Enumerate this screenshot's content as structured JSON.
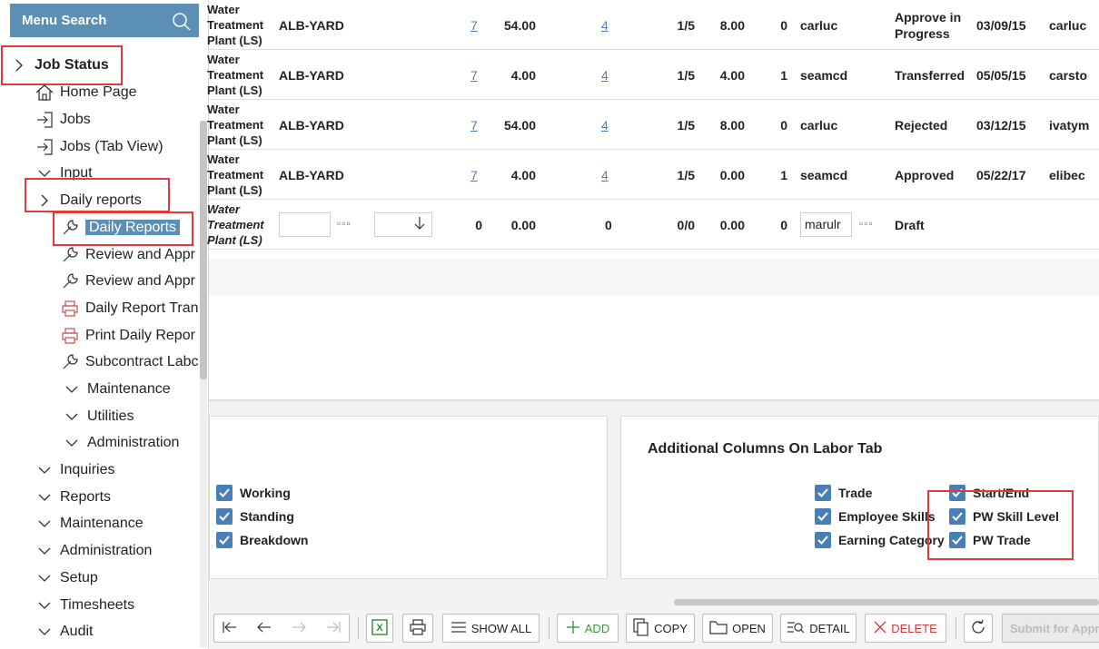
{
  "sidebar": {
    "search_label": "Menu Search",
    "icons": {
      "search": "search-icon",
      "home": "home-icon",
      "arrow_box": "arrow-into-box-icon",
      "wrench": "wrench-icon",
      "printer": "printer-icon"
    },
    "items": [
      {
        "label": "Job Status",
        "expander": ">",
        "icon": ""
      },
      {
        "label": "Home Page",
        "expander": "",
        "icon": "home-icon"
      },
      {
        "label": "Jobs",
        "expander": "",
        "icon": "arrow-into-box-icon"
      },
      {
        "label": "Jobs (Tab View)",
        "expander": "",
        "icon": "arrow-into-box-icon"
      },
      {
        "label": "Input",
        "expander": "v",
        "icon": ""
      },
      {
        "label": "Daily reports",
        "expander": ">",
        "icon": ""
      },
      {
        "label": "Daily Reports",
        "expander": "",
        "icon": "wrench-icon"
      },
      {
        "label": "Review and Appr",
        "expander": "",
        "icon": "wrench-icon"
      },
      {
        "label": "Review and Appr",
        "expander": "",
        "icon": "wrench-icon"
      },
      {
        "label": "Daily Report Tran",
        "expander": "",
        "icon": "printer-icon"
      },
      {
        "label": "Print Daily Repor",
        "expander": "",
        "icon": "printer-icon"
      },
      {
        "label": "Subcontract Labc",
        "expander": "",
        "icon": "wrench-icon"
      },
      {
        "label": "Maintenance",
        "expander": "v",
        "icon": ""
      },
      {
        "label": "Utilities",
        "expander": "v",
        "icon": ""
      },
      {
        "label": "Administration",
        "expander": "v",
        "icon": ""
      },
      {
        "label": "Inquiries",
        "expander": "v",
        "icon": ""
      },
      {
        "label": "Reports",
        "expander": "v",
        "icon": ""
      },
      {
        "label": "Maintenance",
        "expander": "v",
        "icon": ""
      },
      {
        "label": "Administration",
        "expander": "v",
        "icon": ""
      },
      {
        "label": "Setup",
        "expander": "v",
        "icon": ""
      },
      {
        "label": "Timesheets",
        "expander": "v",
        "icon": ""
      },
      {
        "label": "Audit",
        "expander": "v",
        "icon": ""
      }
    ]
  },
  "grid": {
    "rows": [
      {
        "job_line1": "Water",
        "job_line2": "Treatment",
        "job_line3": "Plant (LS)",
        "location": "ALB-YARD",
        "link1": "7",
        "qty": "54.00",
        "link2": "4",
        "ratio": "1/5",
        "hours": "8.00",
        "count": "0",
        "user": "carluc",
        "status_line1": "Approve in",
        "status_line2": "Progress",
        "date": "03/09/15",
        "approver": "carluc"
      },
      {
        "job_line1": "Water",
        "job_line2": "Treatment",
        "job_line3": "Plant (LS)",
        "location": "ALB-YARD",
        "link1": "7",
        "qty": "4.00",
        "link2": "4",
        "ratio": "1/5",
        "hours": "4.00",
        "count": "1",
        "user": "seamcd",
        "status_line1": "Transferred",
        "status_line2": "",
        "date": "05/05/15",
        "approver": "carsto"
      },
      {
        "job_line1": "Water",
        "job_line2": "Treatment",
        "job_line3": "Plant (LS)",
        "location": "ALB-YARD",
        "link1": "7",
        "qty": "54.00",
        "link2": "4",
        "ratio": "1/5",
        "hours": "8.00",
        "count": "0",
        "user": "carluc",
        "status_line1": "Rejected",
        "status_line2": "",
        "date": "03/12/15",
        "approver": "ivatym"
      },
      {
        "job_line1": "Water",
        "job_line2": "Treatment",
        "job_line3": "Plant (LS)",
        "location": "ALB-YARD",
        "link1": "7",
        "qty": "4.00",
        "link2": "4",
        "ratio": "1/5",
        "hours": "0.00",
        "count": "1",
        "user": "seamcd",
        "status_line1": "Approved",
        "status_line2": "",
        "date": "05/22/17",
        "approver": "elibec"
      }
    ],
    "draft_row": {
      "job_line1": "Water",
      "job_line2": "Treatment",
      "job_line3": "Plant (LS)",
      "col_a": "0",
      "qty": "0.00",
      "col_b": "0",
      "ratio": "0/0",
      "hours": "0.00",
      "count": "0",
      "user": "marulr",
      "status": "Draft",
      "dots": "▫▫▫"
    }
  },
  "panel_left": {
    "checkboxes": [
      {
        "label": "Working",
        "checked": true
      },
      {
        "label": "Standing",
        "checked": true
      },
      {
        "label": "Breakdown",
        "checked": true
      }
    ]
  },
  "panel_right": {
    "title": "Additional Columns On Labor Tab",
    "checkboxes_col1": [
      {
        "label": "Trade",
        "checked": true
      },
      {
        "label": "Employee Skills",
        "checked": true
      },
      {
        "label": "Earning Category",
        "checked": true
      }
    ],
    "checkboxes_col2": [
      {
        "label": "Start/End",
        "checked": true
      },
      {
        "label": "PW Skill Level",
        "checked": true
      },
      {
        "label": "PW Trade",
        "checked": true
      }
    ]
  },
  "toolbar": {
    "show_all": "SHOW ALL",
    "add": "ADD",
    "copy": "COPY",
    "open": "OPEN",
    "detail": "DETAIL",
    "delete": "DELETE",
    "submit": "Submit for Appro"
  },
  "colors": {
    "accent": "#5b8fb4",
    "highlight_box": "#e03a3a",
    "checkbox": "#4a7fb5",
    "link": "#4a7eb8",
    "add_green": "#3c9a3c",
    "delete_red": "#d23b3b"
  }
}
